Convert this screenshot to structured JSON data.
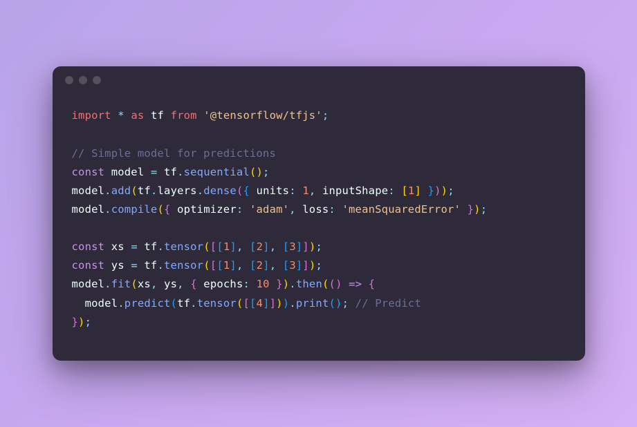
{
  "code": {
    "lines": [
      {
        "tokens": [
          {
            "cls": "kw",
            "text": "import"
          },
          {
            "cls": "white",
            "text": " "
          },
          {
            "cls": "op",
            "text": "*"
          },
          {
            "cls": "white",
            "text": " "
          },
          {
            "cls": "kw",
            "text": "as"
          },
          {
            "cls": "white",
            "text": " tf "
          },
          {
            "cls": "kw",
            "text": "from"
          },
          {
            "cls": "white",
            "text": " "
          },
          {
            "cls": "str",
            "text": "'@tensorflow/tfjs'"
          },
          {
            "cls": "punct",
            "text": ";"
          }
        ]
      },
      {
        "tokens": [
          {
            "cls": "white",
            "text": ""
          }
        ]
      },
      {
        "tokens": [
          {
            "cls": "comment",
            "text": "// Simple model for predictions"
          }
        ]
      },
      {
        "tokens": [
          {
            "cls": "kw2",
            "text": "const"
          },
          {
            "cls": "white",
            "text": " model "
          },
          {
            "cls": "op",
            "text": "="
          },
          {
            "cls": "white",
            "text": " tf"
          },
          {
            "cls": "punct",
            "text": "."
          },
          {
            "cls": "ident",
            "text": "sequential"
          },
          {
            "cls": "paren",
            "text": "()"
          },
          {
            "cls": "punct",
            "text": ";"
          }
        ]
      },
      {
        "tokens": [
          {
            "cls": "white",
            "text": "model"
          },
          {
            "cls": "punct",
            "text": "."
          },
          {
            "cls": "ident",
            "text": "add"
          },
          {
            "cls": "paren",
            "text": "("
          },
          {
            "cls": "white",
            "text": "tf"
          },
          {
            "cls": "punct",
            "text": "."
          },
          {
            "cls": "white",
            "text": "layers"
          },
          {
            "cls": "punct",
            "text": "."
          },
          {
            "cls": "ident",
            "text": "dense"
          },
          {
            "cls": "paren2",
            "text": "("
          },
          {
            "cls": "paren3",
            "text": "{"
          },
          {
            "cls": "white",
            "text": " units"
          },
          {
            "cls": "op",
            "text": ":"
          },
          {
            "cls": "white",
            "text": " "
          },
          {
            "cls": "num",
            "text": "1"
          },
          {
            "cls": "punct",
            "text": ","
          },
          {
            "cls": "white",
            "text": " inputShape"
          },
          {
            "cls": "op",
            "text": ":"
          },
          {
            "cls": "white",
            "text": " "
          },
          {
            "cls": "paren",
            "text": "["
          },
          {
            "cls": "num",
            "text": "1"
          },
          {
            "cls": "paren",
            "text": "]"
          },
          {
            "cls": "white",
            "text": " "
          },
          {
            "cls": "paren3",
            "text": "}"
          },
          {
            "cls": "paren2",
            "text": ")"
          },
          {
            "cls": "paren",
            "text": ")"
          },
          {
            "cls": "punct",
            "text": ";"
          }
        ]
      },
      {
        "tokens": [
          {
            "cls": "white",
            "text": "model"
          },
          {
            "cls": "punct",
            "text": "."
          },
          {
            "cls": "ident",
            "text": "compile"
          },
          {
            "cls": "paren",
            "text": "("
          },
          {
            "cls": "paren2",
            "text": "{"
          },
          {
            "cls": "white",
            "text": " optimizer"
          },
          {
            "cls": "op",
            "text": ":"
          },
          {
            "cls": "white",
            "text": " "
          },
          {
            "cls": "str",
            "text": "'adam'"
          },
          {
            "cls": "punct",
            "text": ","
          },
          {
            "cls": "white",
            "text": " loss"
          },
          {
            "cls": "op",
            "text": ":"
          },
          {
            "cls": "white",
            "text": " "
          },
          {
            "cls": "str",
            "text": "'meanSquaredError'"
          },
          {
            "cls": "white",
            "text": " "
          },
          {
            "cls": "paren2",
            "text": "}"
          },
          {
            "cls": "paren",
            "text": ")"
          },
          {
            "cls": "punct",
            "text": ";"
          }
        ]
      },
      {
        "tokens": [
          {
            "cls": "white",
            "text": ""
          }
        ]
      },
      {
        "tokens": [
          {
            "cls": "kw2",
            "text": "const"
          },
          {
            "cls": "white",
            "text": " xs "
          },
          {
            "cls": "op",
            "text": "="
          },
          {
            "cls": "white",
            "text": " tf"
          },
          {
            "cls": "punct",
            "text": "."
          },
          {
            "cls": "ident",
            "text": "tensor"
          },
          {
            "cls": "paren",
            "text": "("
          },
          {
            "cls": "paren2",
            "text": "["
          },
          {
            "cls": "paren3",
            "text": "["
          },
          {
            "cls": "num",
            "text": "1"
          },
          {
            "cls": "paren3",
            "text": "]"
          },
          {
            "cls": "punct",
            "text": ","
          },
          {
            "cls": "white",
            "text": " "
          },
          {
            "cls": "paren3",
            "text": "["
          },
          {
            "cls": "num",
            "text": "2"
          },
          {
            "cls": "paren3",
            "text": "]"
          },
          {
            "cls": "punct",
            "text": ","
          },
          {
            "cls": "white",
            "text": " "
          },
          {
            "cls": "paren3",
            "text": "["
          },
          {
            "cls": "num",
            "text": "3"
          },
          {
            "cls": "paren3",
            "text": "]"
          },
          {
            "cls": "paren2",
            "text": "]"
          },
          {
            "cls": "paren",
            "text": ")"
          },
          {
            "cls": "punct",
            "text": ";"
          }
        ]
      },
      {
        "tokens": [
          {
            "cls": "kw2",
            "text": "const"
          },
          {
            "cls": "white",
            "text": " ys "
          },
          {
            "cls": "op",
            "text": "="
          },
          {
            "cls": "white",
            "text": " tf"
          },
          {
            "cls": "punct",
            "text": "."
          },
          {
            "cls": "ident",
            "text": "tensor"
          },
          {
            "cls": "paren",
            "text": "("
          },
          {
            "cls": "paren2",
            "text": "["
          },
          {
            "cls": "paren3",
            "text": "["
          },
          {
            "cls": "num",
            "text": "1"
          },
          {
            "cls": "paren3",
            "text": "]"
          },
          {
            "cls": "punct",
            "text": ","
          },
          {
            "cls": "white",
            "text": " "
          },
          {
            "cls": "paren3",
            "text": "["
          },
          {
            "cls": "num",
            "text": "2"
          },
          {
            "cls": "paren3",
            "text": "]"
          },
          {
            "cls": "punct",
            "text": ","
          },
          {
            "cls": "white",
            "text": " "
          },
          {
            "cls": "paren3",
            "text": "["
          },
          {
            "cls": "num",
            "text": "3"
          },
          {
            "cls": "paren3",
            "text": "]"
          },
          {
            "cls": "paren2",
            "text": "]"
          },
          {
            "cls": "paren",
            "text": ")"
          },
          {
            "cls": "punct",
            "text": ";"
          }
        ]
      },
      {
        "tokens": [
          {
            "cls": "white",
            "text": "model"
          },
          {
            "cls": "punct",
            "text": "."
          },
          {
            "cls": "ident",
            "text": "fit"
          },
          {
            "cls": "paren",
            "text": "("
          },
          {
            "cls": "white",
            "text": "xs"
          },
          {
            "cls": "punct",
            "text": ","
          },
          {
            "cls": "white",
            "text": " ys"
          },
          {
            "cls": "punct",
            "text": ","
          },
          {
            "cls": "white",
            "text": " "
          },
          {
            "cls": "paren2",
            "text": "{"
          },
          {
            "cls": "white",
            "text": " epochs"
          },
          {
            "cls": "op",
            "text": ":"
          },
          {
            "cls": "white",
            "text": " "
          },
          {
            "cls": "num",
            "text": "10"
          },
          {
            "cls": "white",
            "text": " "
          },
          {
            "cls": "paren2",
            "text": "}"
          },
          {
            "cls": "paren",
            "text": ")"
          },
          {
            "cls": "punct",
            "text": "."
          },
          {
            "cls": "ident",
            "text": "then"
          },
          {
            "cls": "paren",
            "text": "("
          },
          {
            "cls": "paren2",
            "text": "()"
          },
          {
            "cls": "white",
            "text": " "
          },
          {
            "cls": "kw2",
            "text": "=>"
          },
          {
            "cls": "white",
            "text": " "
          },
          {
            "cls": "paren2",
            "text": "{"
          }
        ]
      },
      {
        "tokens": [
          {
            "cls": "white",
            "text": "  model"
          },
          {
            "cls": "punct",
            "text": "."
          },
          {
            "cls": "ident",
            "text": "predict"
          },
          {
            "cls": "paren3",
            "text": "("
          },
          {
            "cls": "white",
            "text": "tf"
          },
          {
            "cls": "punct",
            "text": "."
          },
          {
            "cls": "ident",
            "text": "tensor"
          },
          {
            "cls": "paren",
            "text": "("
          },
          {
            "cls": "paren2",
            "text": "["
          },
          {
            "cls": "paren3",
            "text": "["
          },
          {
            "cls": "num",
            "text": "4"
          },
          {
            "cls": "paren3",
            "text": "]"
          },
          {
            "cls": "paren2",
            "text": "]"
          },
          {
            "cls": "paren",
            "text": ")"
          },
          {
            "cls": "paren3",
            "text": ")"
          },
          {
            "cls": "punct",
            "text": "."
          },
          {
            "cls": "ident",
            "text": "print"
          },
          {
            "cls": "paren3",
            "text": "()"
          },
          {
            "cls": "punct",
            "text": ";"
          },
          {
            "cls": "white",
            "text": " "
          },
          {
            "cls": "comment",
            "text": "// Predict"
          }
        ]
      },
      {
        "tokens": [
          {
            "cls": "paren2",
            "text": "}"
          },
          {
            "cls": "paren",
            "text": ")"
          },
          {
            "cls": "punct",
            "text": ";"
          }
        ]
      }
    ]
  }
}
